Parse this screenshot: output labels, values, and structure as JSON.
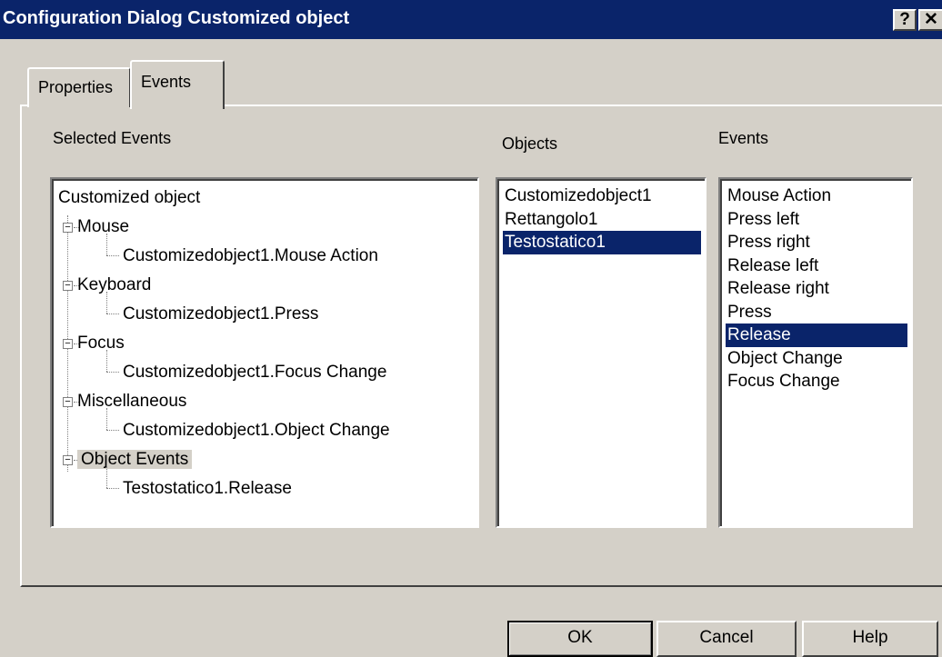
{
  "window": {
    "title": "Configuration Dialog Customized object",
    "help_button": "?",
    "close_button": "✕"
  },
  "tabs": [
    {
      "label": "Properties",
      "active": false
    },
    {
      "label": "Events",
      "active": true
    }
  ],
  "selected_events": {
    "label": "Selected Events",
    "root": "Customized object",
    "groups": [
      {
        "label": "Mouse",
        "child": "Customizedobject1.Mouse Action"
      },
      {
        "label": "Keyboard",
        "child": "Customizedobject1.Press"
      },
      {
        "label": "Focus",
        "child": "Customizedobject1.Focus Change"
      },
      {
        "label": "Miscellaneous",
        "child": "Customizedobject1.Object Change"
      },
      {
        "label": "Object Events",
        "child": "Testostatico1.Release"
      }
    ],
    "expander_symbol": "−"
  },
  "objects": {
    "label": "Objects",
    "items": [
      "Customizedobject1",
      "Rettangolo1",
      "Testostatico1"
    ],
    "selected": "Testostatico1"
  },
  "events": {
    "label": "Events",
    "items": [
      "Mouse Action",
      "Press left",
      "Press right",
      "Release left",
      "Release right",
      "Press",
      "Release",
      "Object Change",
      "Focus Change"
    ],
    "selected": "Release"
  },
  "buttons": {
    "ok": "OK",
    "cancel": "Cancel",
    "help": "Help"
  }
}
